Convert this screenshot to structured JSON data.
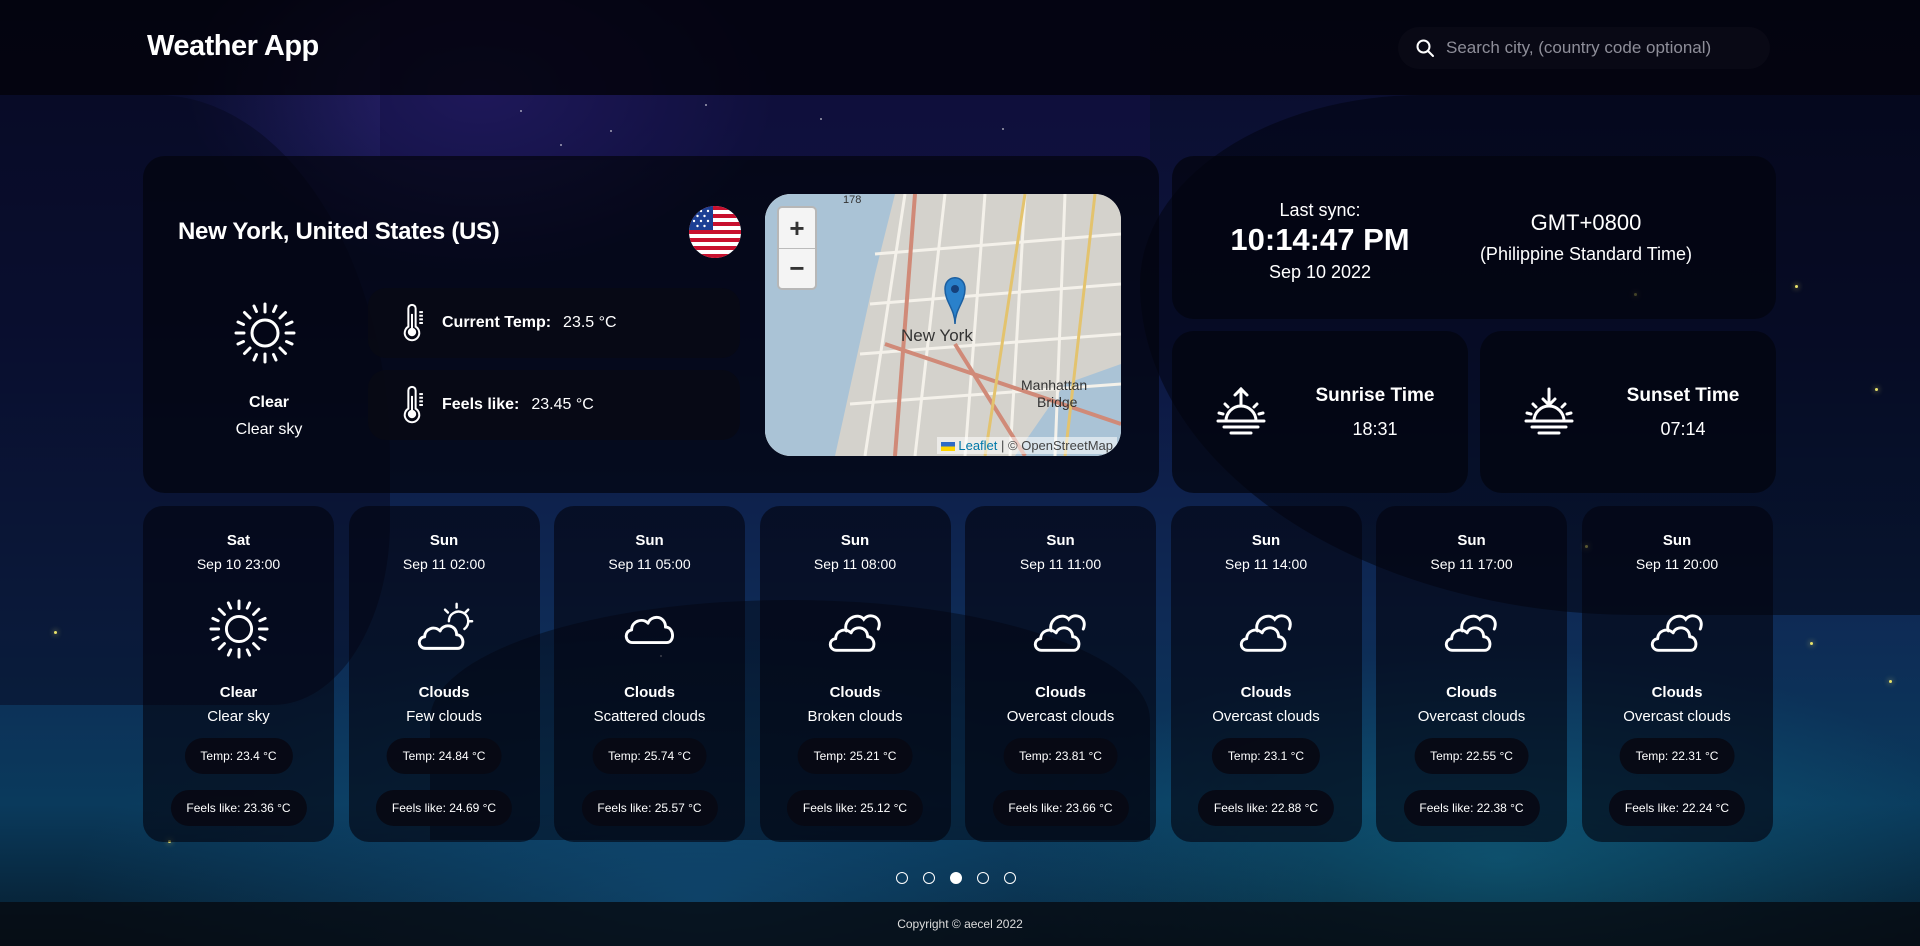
{
  "header": {
    "title": "Weather App",
    "search_placeholder": "Search city, (country code optional)",
    "search_value": ""
  },
  "current": {
    "location": "New York, United States (US)",
    "flag": "us-flag",
    "icon": "sun-icon",
    "condition": "Clear",
    "description": "Clear sky",
    "current_temp_label": "Current Temp:",
    "current_temp_value": "23.5 °C",
    "feels_like_label": "Feels like:",
    "feels_like_value": "23.45 °C"
  },
  "map": {
    "zoom_in": "+",
    "zoom_out": "−",
    "labels": {
      "city": "New York",
      "manhattan": "Manhattan",
      "bridge": "Bridge",
      "road": "178"
    },
    "attribution_link": "Leaflet",
    "attribution_text": "| © OpenStreetMap"
  },
  "sync": {
    "label": "Last sync:",
    "time": "10:14:47 PM",
    "date": "Sep 10 2022",
    "tz_offset": "GMT+0800",
    "tz_name": "(Philippine Standard Time)"
  },
  "sunrise": {
    "title": "Sunrise Time",
    "time": "18:31",
    "icon": "sunrise-icon"
  },
  "sunset": {
    "title": "Sunset Time",
    "time": "07:14",
    "icon": "sunset-icon"
  },
  "forecast": [
    {
      "day": "Sat",
      "datetime": "Sep 10 23:00",
      "icon": "sun-icon",
      "condition": "Clear",
      "description": "Clear sky",
      "temp": "Temp: 23.4 °C",
      "feels": "Feels like: 23.36 °C"
    },
    {
      "day": "Sun",
      "datetime": "Sep 11 02:00",
      "icon": "cloud-sun-icon",
      "condition": "Clouds",
      "description": "Few clouds",
      "temp": "Temp: 24.84 °C",
      "feels": "Feels like: 24.69 °C"
    },
    {
      "day": "Sun",
      "datetime": "Sep 11 05:00",
      "icon": "cloud-icon",
      "condition": "Clouds",
      "description": "Scattered clouds",
      "temp": "Temp: 25.74 °C",
      "feels": "Feels like: 25.57 °C"
    },
    {
      "day": "Sun",
      "datetime": "Sep 11 08:00",
      "icon": "clouds-icon",
      "condition": "Clouds",
      "description": "Broken clouds",
      "temp": "Temp: 25.21 °C",
      "feels": "Feels like: 25.12 °C"
    },
    {
      "day": "Sun",
      "datetime": "Sep 11 11:00",
      "icon": "clouds-icon",
      "condition": "Clouds",
      "description": "Overcast clouds",
      "temp": "Temp: 23.81 °C",
      "feels": "Feels like: 23.66 °C"
    },
    {
      "day": "Sun",
      "datetime": "Sep 11 14:00",
      "icon": "clouds-icon",
      "condition": "Clouds",
      "description": "Overcast clouds",
      "temp": "Temp: 23.1 °C",
      "feels": "Feels like: 22.88 °C"
    },
    {
      "day": "Sun",
      "datetime": "Sep 11 17:00",
      "icon": "clouds-icon",
      "condition": "Clouds",
      "description": "Overcast clouds",
      "temp": "Temp: 22.55 °C",
      "feels": "Feels like: 22.38 °C"
    },
    {
      "day": "Sun",
      "datetime": "Sep 11 20:00",
      "icon": "clouds-icon",
      "condition": "Clouds",
      "description": "Overcast clouds",
      "temp": "Temp: 22.31 °C",
      "feels": "Feels like: 22.24 °C"
    }
  ],
  "pagination": {
    "count": 5,
    "active_index": 2
  },
  "footer": {
    "copyright": "Copyright © aecel 2022"
  }
}
